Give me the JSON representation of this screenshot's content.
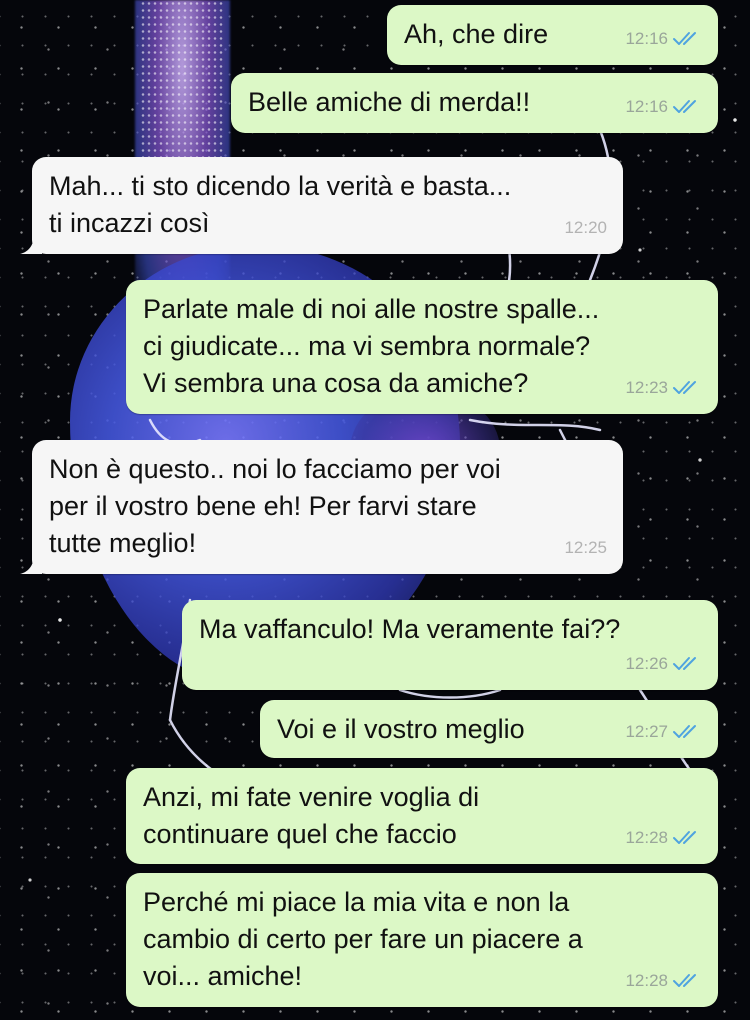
{
  "theme": {
    "outgoing_bubble": "#dcf8c6",
    "incoming_bubble": "#f6f6f6",
    "read_ticks": "#4fa3e0",
    "wallpaper": "#05060b"
  },
  "messages": [
    {
      "direction": "outgoing",
      "text": "Ah, che dire",
      "time": "12:16",
      "status": "read"
    },
    {
      "direction": "outgoing",
      "text": "Belle amiche di merda!!",
      "time": "12:16",
      "status": "read"
    },
    {
      "direction": "incoming",
      "text": "Mah... ti sto dicendo la verità e basta...\nti incazzi così",
      "time": "12:20"
    },
    {
      "direction": "outgoing",
      "text": "Parlate male di noi alle nostre spalle...\nci giudicate... ma vi sembra normale?\nVi sembra una cosa da amiche?",
      "time": "12:23",
      "status": "read"
    },
    {
      "direction": "incoming",
      "text": "Non è questo.. noi lo facciamo per voi\nper il vostro bene eh! Per farvi stare\ntutte meglio!",
      "time": "12:25"
    },
    {
      "direction": "outgoing",
      "text": "Ma vaffanculo! Ma veramente fai??",
      "time": "12:26",
      "status": "read"
    },
    {
      "direction": "outgoing",
      "text": "Voi e il vostro meglio",
      "time": "12:27",
      "status": "read"
    },
    {
      "direction": "outgoing",
      "text": "Anzi, mi fate venire voglia di\ncontinuare quel che faccio",
      "time": "12:28",
      "status": "read"
    },
    {
      "direction": "outgoing",
      "text": "Perché mi piace la mia vita e non la\ncambio di certo per fare un piacere a\nvoi... amiche!",
      "time": "12:28",
      "status": "read"
    }
  ]
}
